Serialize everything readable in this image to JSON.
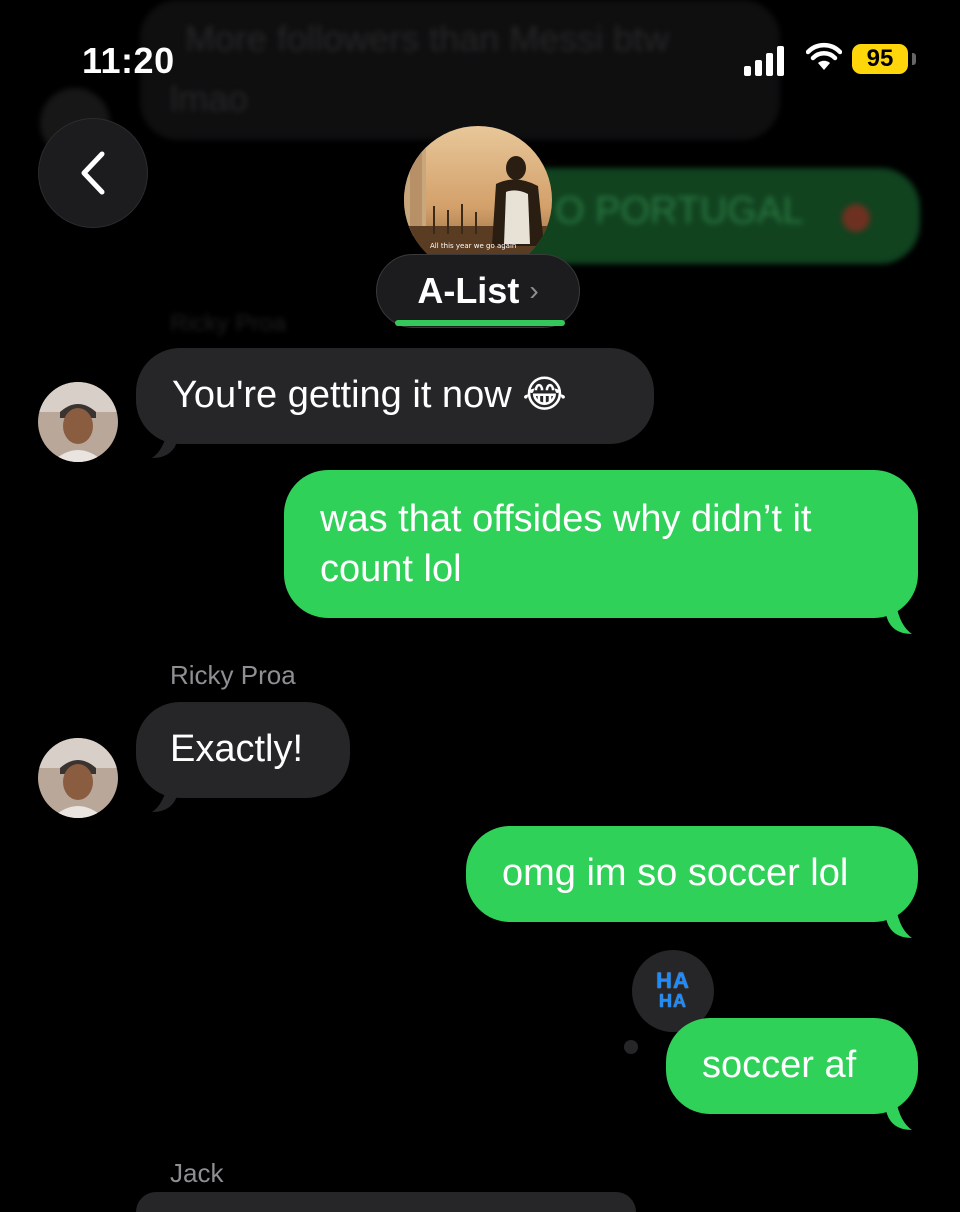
{
  "status_bar": {
    "time": "11:20",
    "battery": "95",
    "battery_color": "#ffd60a"
  },
  "background_faded": {
    "message_1": "More followers than Messi btw",
    "message_2": "lmao",
    "message_3": "O PORTUGAL",
    "sender_top": "Ricky Proa"
  },
  "header": {
    "back_icon": "chevron-left-icon",
    "group_name": "A-List",
    "group_chevron": "›",
    "group_photo_caption": "All this year we go again",
    "accent": "#34c759"
  },
  "messages": [
    {
      "sender": "Ricky Proa",
      "text": "You're getting it now 😂",
      "direction": "incoming"
    },
    {
      "text_line1": "was that offsides why didn’t it",
      "text_line2": "count lol",
      "direction": "outgoing"
    },
    {
      "sender": "Ricky Proa",
      "text": "Exactly!",
      "direction": "incoming"
    },
    {
      "text": "omg im so soccer lol",
      "direction": "outgoing"
    },
    {
      "text": "soccer af",
      "direction": "outgoing",
      "tapback_line1": "HA",
      "tapback_line2": "HA"
    }
  ],
  "next_sender": "Jack",
  "colors": {
    "outgoing_bubble": "#30d158",
    "incoming_bubble": "#262628",
    "sender_label": "#8e8e93"
  }
}
